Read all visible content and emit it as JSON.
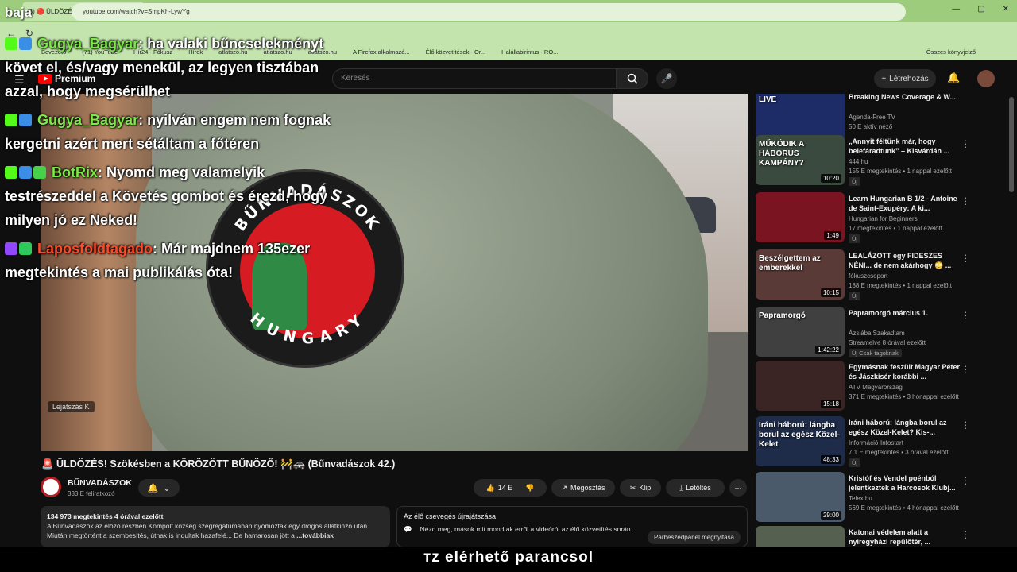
{
  "overlay": {
    "corner_label": "baja"
  },
  "browser": {
    "tab_title": "(3) 🔴 ÜLDÖZÉS! Szökésben a K",
    "url": "youtube.com/watch?v=SmpKh-LywYg",
    "bookmarks": [
      "Bevezető",
      "(71) YouTube",
      "Hír24 - Fókusz",
      "Hírek",
      "atlatszo.hu",
      "atlatszo.hu",
      "atlatszo.hu",
      "A Firefox alkalmazá...",
      "Élő közvetítések - Or...",
      "Halállabirintus - RO..."
    ],
    "bookmarks_right": "Összes könyvjelző"
  },
  "header": {
    "logo": "Premium",
    "search_placeholder": "Keresés",
    "create_label": "Létrehozás"
  },
  "chat": [
    {
      "user": "Gugya_Bagyar",
      "text": ": ha valaki bűncselekményt követ el, és/vagy menekül, az legyen tisztában azzal, hogy megsérülhet",
      "badges": [
        "kick",
        "blue"
      ],
      "name_color": "green"
    },
    {
      "user": "Gugya_Bagyar",
      "text": ": nyilván engem nem fognak kergetni azért mert sétáltam a főtéren",
      "badges": [
        "kick",
        "blue"
      ],
      "name_color": "green"
    },
    {
      "user": "BotRix",
      "text": ": Nyomd meg valamelyik testrészeddel a Követés gombot és érezd, hogy milyen jó ez Neked!",
      "badges": [
        "kick",
        "blue",
        "bot"
      ],
      "name_color": "green"
    },
    {
      "user": "Laposfoldtagado",
      "text": ": Már majdnem 135ezer megtekintés a mai publikálás óta!",
      "badges": [
        "twitch",
        "check"
      ],
      "name_color": "red"
    }
  ],
  "video": {
    "patch_top": "BŰNVADÁSZOK",
    "patch_bottom": "HUNGARY",
    "playing_label": "Lejátszás",
    "playing_key": "K"
  },
  "meta": {
    "title": "🚨 ÜLDÖZÉS! Szökésben a KÖRÖZÖTT BŰNÖZŐ! 🚧🚓 (Bűnvadászok 42.)",
    "channel": "BŰNVADÁSZOK",
    "subs": "333 E feliratkozó",
    "likes": "14 E",
    "share": "Megosztás",
    "clip": "Klip",
    "download": "Letöltés",
    "views_time": "134 973 megtekintés  4 órával ezelőtt",
    "description": "A Bűnvadászok az előző részben Kompolt község szegregátumában nyomoztak egy drogos állatkinzó után. Miután megtörtént a szembesítés, útnak is indultak hazafelé... De hamarosan jött a",
    "more": "...továbbiak"
  },
  "livechat": {
    "title": "Az élő csevegés újrajátszása",
    "body": "Nézd meg, mások mit mondtak erről a videóról az élő közvetítés során.",
    "open": "Párbeszédpanel megnyitása"
  },
  "recommendations": [
    {
      "title": "Breaking News Coverage & W...",
      "channel": "Agenda-Free TV",
      "meta": "50 E aktív néző",
      "duration": "",
      "tag": "",
      "thumb_text": "LIVE",
      "color": "#1d2b66"
    },
    {
      "title": "„Annyit féltünk már, hogy belefáradtunk” – Kisvárdán ...",
      "channel": "444.hu",
      "meta": "155 E megtekintés • 1 nappal ezelőtt",
      "duration": "10:20",
      "tag": "Új",
      "thumb_text": "MŰKÖDIK A HÁBORÚS KAMPÁNY?",
      "color": "#3b4a3e"
    },
    {
      "title": "Learn Hungarian B 1/2 - Antoine de Saint-Exupéry: A ki...",
      "channel": "Hungarian for Beginners",
      "meta": "17 megtekintés • 1 nappal ezelőtt",
      "duration": "1:49",
      "tag": "Új",
      "thumb_text": "",
      "color": "#7a1420"
    },
    {
      "title": "LEALÁZOTT egy FIDESZES NÉNI... de nem akárhogy 😳 ...",
      "channel": "fókuszcsoport",
      "meta": "188 E megtekintés • 1 nappal ezelőtt",
      "duration": "10:15",
      "tag": "Új",
      "thumb_text": "Beszélgettem az emberekkel",
      "color": "#5a3a36"
    },
    {
      "title": "Papramorgó március 1.",
      "channel": "Ázsiába Szakadtam",
      "meta": "Streamelve 8 órával ezelőtt",
      "duration": "1:42:22",
      "tag": "Új  Csak tagoknak",
      "thumb_text": "Papramorgó",
      "color": "#404040"
    },
    {
      "title": "Egymásnak feszült Magyar Péter és Jászkisér korábbi ...",
      "channel": "ATV Magyarország",
      "meta": "371 E megtekintés • 3 hónappal ezelőtt",
      "duration": "15:18",
      "tag": "",
      "thumb_text": "",
      "color": "#3a2424"
    },
    {
      "title": "Iráni háború: lángba borul az egész Közel-Kelet? Kis-...",
      "channel": "Információ-Infostart",
      "meta": "7,1 E megtekintés • 3 órával ezelőtt",
      "duration": "48:33",
      "tag": "Új",
      "thumb_text": "Iráni háború: lángba borul az egész Közel-Kelet",
      "color": "#1e2c4a"
    },
    {
      "title": "Kristóf és Vendel poénból jelentkeztek a Harcosok Klubj...",
      "channel": "Telex.hu",
      "meta": "569 E megtekintés • 4 hónappal ezelőtt",
      "duration": "29:00",
      "tag": "",
      "thumb_text": "",
      "color": "#4a5a6a"
    },
    {
      "title": "Katonai védelem alatt a nyíregyházi repülőtér, ...",
      "channel": "",
      "meta": "",
      "duration": "",
      "tag": "",
      "thumb_text": "",
      "color": "#556050"
    }
  ],
  "caption": "тz elérhető parancsol"
}
